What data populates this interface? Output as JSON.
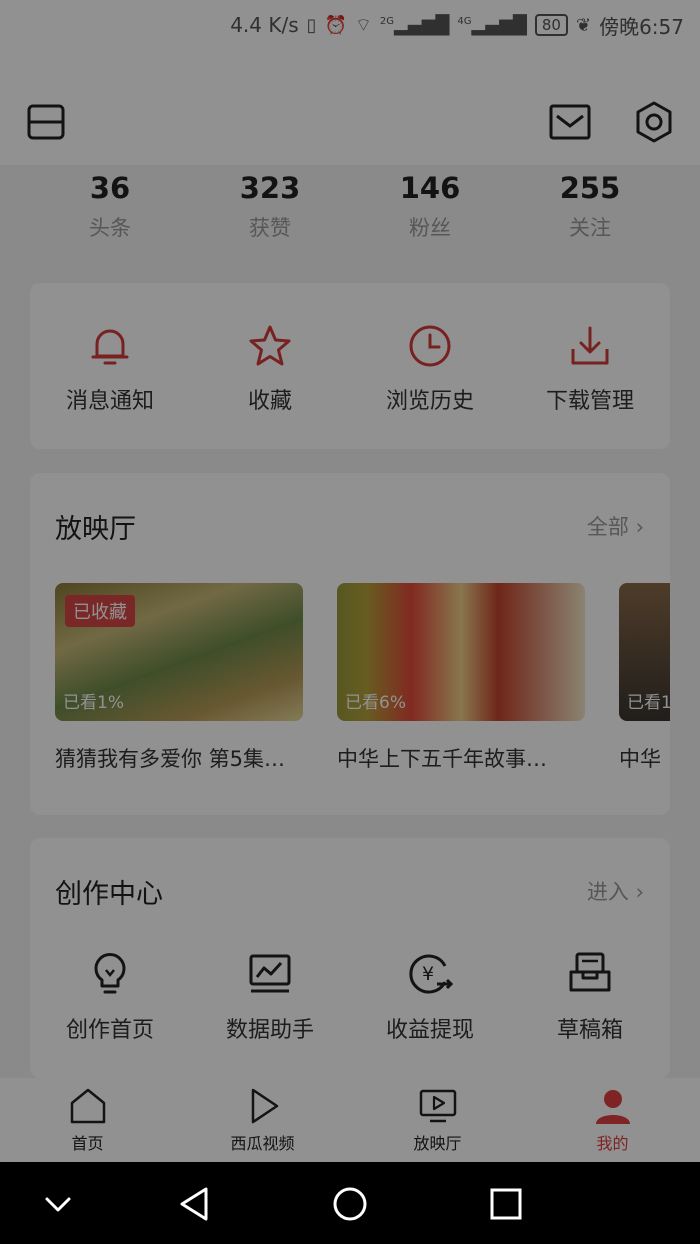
{
  "status_bar": {
    "speed": "4.4 K/s",
    "net1": "2G",
    "net2": "4G",
    "battery": "80",
    "time": "傍晚6:57"
  },
  "stats": [
    {
      "value": "36",
      "label": "头条"
    },
    {
      "value": "323",
      "label": "获赞"
    },
    {
      "value": "146",
      "label": "粉丝"
    },
    {
      "value": "255",
      "label": "关注"
    }
  ],
  "quick_actions": [
    {
      "icon": "bell-icon",
      "label": "消息通知"
    },
    {
      "icon": "star-icon",
      "label": "收藏"
    },
    {
      "icon": "clock-icon",
      "label": "浏览历史"
    },
    {
      "icon": "download-icon",
      "label": "下载管理"
    }
  ],
  "theater": {
    "title": "放映厅",
    "more": "全部 ›",
    "items": [
      {
        "badge": "已收藏",
        "progress": "已看1%",
        "caption": "猜猜我有多爱你 第5集…"
      },
      {
        "badge": "",
        "progress": "已看6%",
        "caption": "中华上下五千年故事…"
      },
      {
        "badge": "",
        "progress": "已看1",
        "caption": "中华"
      }
    ]
  },
  "creator": {
    "title": "创作中心",
    "more": "进入 ›",
    "items": [
      {
        "icon": "lightbulb-icon",
        "label": "创作首页"
      },
      {
        "icon": "chart-icon",
        "label": "数据助手"
      },
      {
        "icon": "yuan-icon",
        "label": "收益提现"
      },
      {
        "icon": "draft-box-icon",
        "label": "草稿箱"
      }
    ]
  },
  "tabbar": [
    {
      "icon": "home-icon",
      "label": "首页",
      "active": false
    },
    {
      "icon": "play-icon",
      "label": "西瓜视频",
      "active": false
    },
    {
      "icon": "tv-icon",
      "label": "放映厅",
      "active": false
    },
    {
      "icon": "user-icon",
      "label": "我的",
      "active": true
    }
  ],
  "colors": {
    "accent": "#e04040",
    "icon_red": "#d23b3b"
  }
}
